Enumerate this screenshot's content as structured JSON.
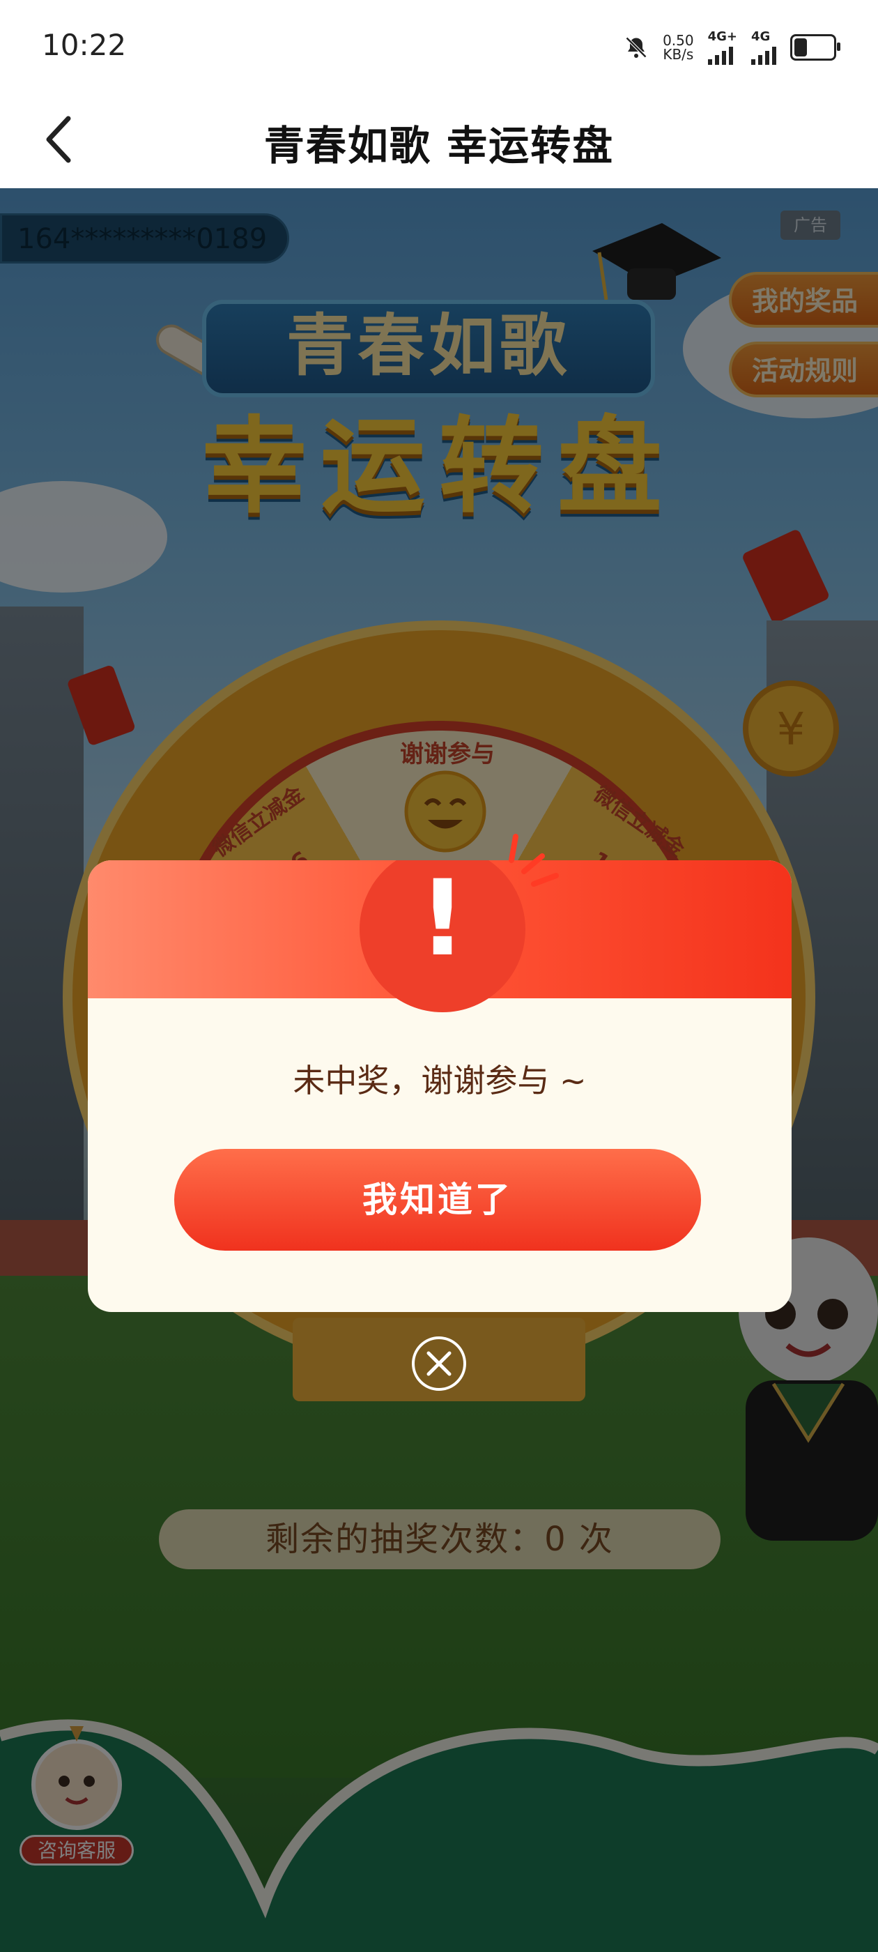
{
  "status_bar": {
    "time": "10:22",
    "speed_value": "0.50",
    "speed_unit": "KB/s",
    "net1": "4G+",
    "net2": "4G"
  },
  "nav": {
    "title": "青春如歌 幸运转盘"
  },
  "game": {
    "phone_masked": "164*********0189",
    "ad_label": "广告",
    "my_prizes": "我的奖品",
    "rules": "活动规则",
    "title_top": "青春如歌",
    "title_main": "幸运转盘",
    "wheel_segments": [
      "谢谢参与",
      "微信立减金",
      "微信立减金"
    ],
    "prize_left_amount": "6.66",
    "prize_right_amount": "1.88",
    "remaining_text": "剩余的抽奖次数：0 次",
    "service_label": "咨询客服"
  },
  "dialog": {
    "icon_glyph": "!",
    "message": "未中奖，谢谢参与 ~",
    "confirm_label": "我知道了"
  },
  "colors": {
    "accent_red": "#f0321e",
    "dialog_bg": "#fefaee",
    "text_brown": "#5a2a14"
  }
}
